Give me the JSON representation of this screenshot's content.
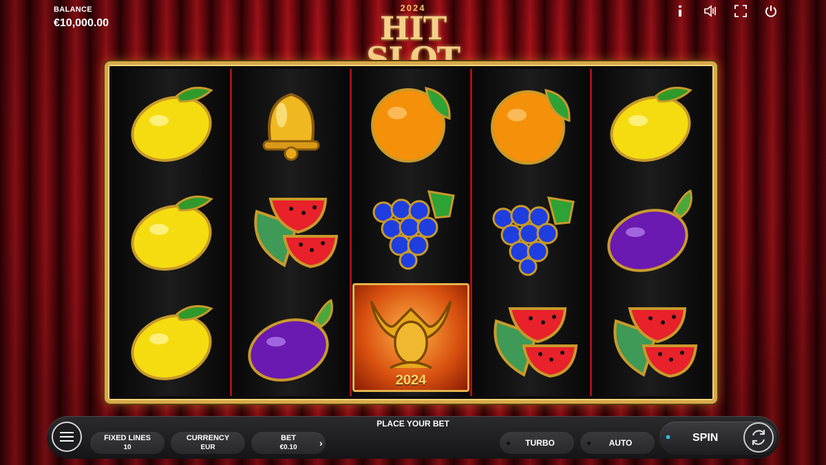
{
  "header": {
    "balance_label": "BALANCE",
    "balance_value": "€10,000.00",
    "logo_year": "2024",
    "logo_title": "HIT SLOT",
    "icons": [
      "info-icon",
      "sound-icon",
      "fullscreen-icon",
      "power-icon"
    ]
  },
  "reels": [
    [
      "lemon",
      "lemon",
      "lemon"
    ],
    [
      "bell",
      "watermelon",
      "plum"
    ],
    [
      "orange",
      "grapes",
      "joker"
    ],
    [
      "orange",
      "grapes",
      "watermelon"
    ],
    [
      "lemon",
      "plum",
      "watermelon"
    ]
  ],
  "joker_year": "2024",
  "controls": {
    "place_bet": "PLACE YOUR BET",
    "fixed_lines_label": "FIXED LINES",
    "fixed_lines_value": "10",
    "currency_label": "CURRENCY",
    "currency_value": "EUR",
    "bet_label": "BET",
    "bet_value": "€0.10",
    "bet_arrow": "›",
    "turbo": "TURBO",
    "auto": "AUTO",
    "spin": "SPIN"
  },
  "colors": {
    "frame_gold": "#d6a94a",
    "reel_divider": "#a8101a",
    "spin_indicator": "#22c7e0"
  }
}
